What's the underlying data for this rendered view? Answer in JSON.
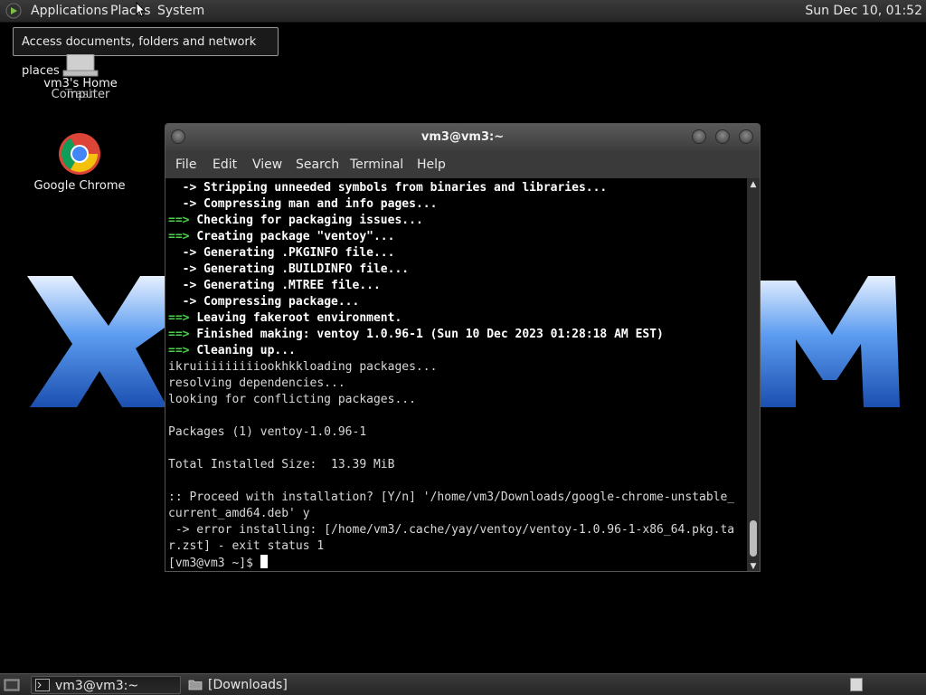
{
  "top_panel": {
    "menus": [
      "Applications",
      "Places",
      "System"
    ],
    "clock": "Sun Dec 10, 01:52"
  },
  "tooltip": "Access documents, folders and network places",
  "desktop_icons": {
    "home": "vm3's Home",
    "computer": "Computer",
    "trash": "Trash",
    "chrome": "Google Chrome"
  },
  "terminal": {
    "title": "vm3@vm3:~",
    "menus": [
      "File",
      "Edit",
      "View",
      "Search",
      "Terminal",
      "Help"
    ],
    "lines": [
      {
        "prefix": "  -> ",
        "text": "Stripping unneeded symbols from binaries and libraries...",
        "style": "arrow"
      },
      {
        "prefix": "  -> ",
        "text": "Compressing man and info pages...",
        "style": "arrow"
      },
      {
        "prefix": "==> ",
        "text": "Checking for packaging issues...",
        "style": "step"
      },
      {
        "prefix": "==> ",
        "text": "Creating package \"ventoy\"...",
        "style": "step"
      },
      {
        "prefix": "  -> ",
        "text": "Generating .PKGINFO file...",
        "style": "arrow"
      },
      {
        "prefix": "  -> ",
        "text": "Generating .BUILDINFO file...",
        "style": "arrow"
      },
      {
        "prefix": "  -> ",
        "text": "Generating .MTREE file...",
        "style": "arrow"
      },
      {
        "prefix": "  -> ",
        "text": "Compressing package...",
        "style": "arrow"
      },
      {
        "prefix": "==> ",
        "text": "Leaving fakeroot environment.",
        "style": "step"
      },
      {
        "prefix": "==> ",
        "text": "Finished making: ventoy 1.0.96-1 (Sun 10 Dec 2023 01:28:18 AM EST)",
        "style": "step"
      },
      {
        "prefix": "==> ",
        "text": "Cleaning up...",
        "style": "step"
      },
      {
        "prefix": "",
        "text": "ikruiiiiiiiiiookhkkloading packages...",
        "style": "plain"
      },
      {
        "prefix": "",
        "text": "resolving dependencies...",
        "style": "plain"
      },
      {
        "prefix": "",
        "text": "looking for conflicting packages...",
        "style": "plain"
      },
      {
        "prefix": "",
        "text": "",
        "style": "plain"
      },
      {
        "prefix": "",
        "text": "Packages (1) ventoy-1.0.96-1",
        "style": "plain"
      },
      {
        "prefix": "",
        "text": "",
        "style": "plain"
      },
      {
        "prefix": "",
        "text": "Total Installed Size:  13.39 MiB",
        "style": "plain"
      },
      {
        "prefix": "",
        "text": "",
        "style": "plain"
      },
      {
        "prefix": "",
        "text": ":: Proceed with installation? [Y/n] '/home/vm3/Downloads/google-chrome-unstable_",
        "style": "plain"
      },
      {
        "prefix": "",
        "text": "current_amd64.deb' y",
        "style": "plain"
      },
      {
        "prefix": "",
        "text": " -> error installing: [/home/vm3/.cache/yay/ventoy/ventoy-1.0.96-1-x86_64.pkg.ta",
        "style": "plain"
      },
      {
        "prefix": "",
        "text": "r.zst] - exit status 1",
        "style": "plain"
      }
    ],
    "prompt": "[vm3@vm3 ~]$ "
  },
  "taskbar": {
    "tasks": [
      "vm3@vm3:~",
      "[Downloads]"
    ]
  },
  "colors": {
    "step_prefix": "#4cd04c",
    "panel": "#2e2e2e",
    "logo_blue": "#3a7fe0"
  }
}
